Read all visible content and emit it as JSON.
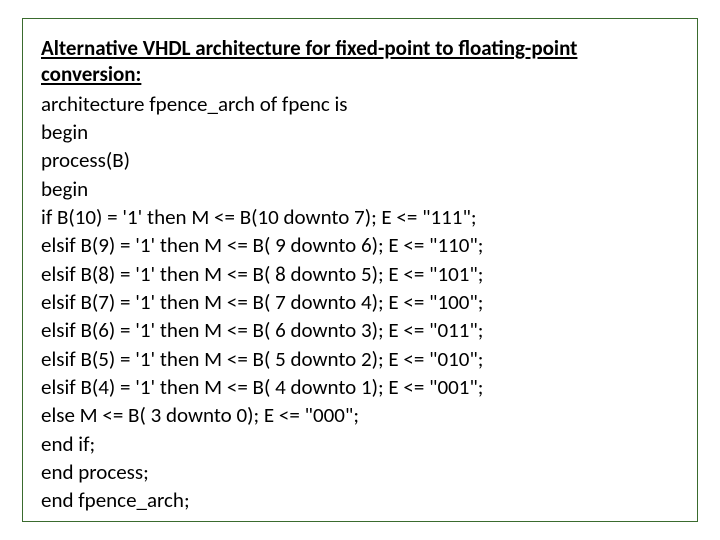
{
  "title_line1": "Alternative VHDL architecture for fixed-point to floating-point",
  "title_line2": "conversion:",
  "code_lines": [
    "architecture fpence_arch of fpenc is",
    "begin",
    "process(B)",
    "begin",
    "if B(10) = '1' then M <= B(10 downto 7); E <= \"111\";",
    "elsif B(9) = '1' then M <= B( 9 downto 6); E <= \"110\";",
    "elsif B(8) = '1' then M <= B( 8 downto 5); E <= \"101\";",
    "elsif B(7) = '1' then M <= B( 7 downto 4); E <= \"100\";",
    "elsif B(6) = '1' then M <= B( 6 downto 3); E <= \"011\";",
    "elsif B(5) = '1' then M <= B( 5 downto 2); E <= \"010\";",
    "elsif B(4) = '1' then M <= B( 4 downto 1); E <= \"001\";",
    "else M <= B( 3 downto 0); E <= \"000\";",
    "end if;",
    "end process;",
    "end fpence_arch;"
  ]
}
